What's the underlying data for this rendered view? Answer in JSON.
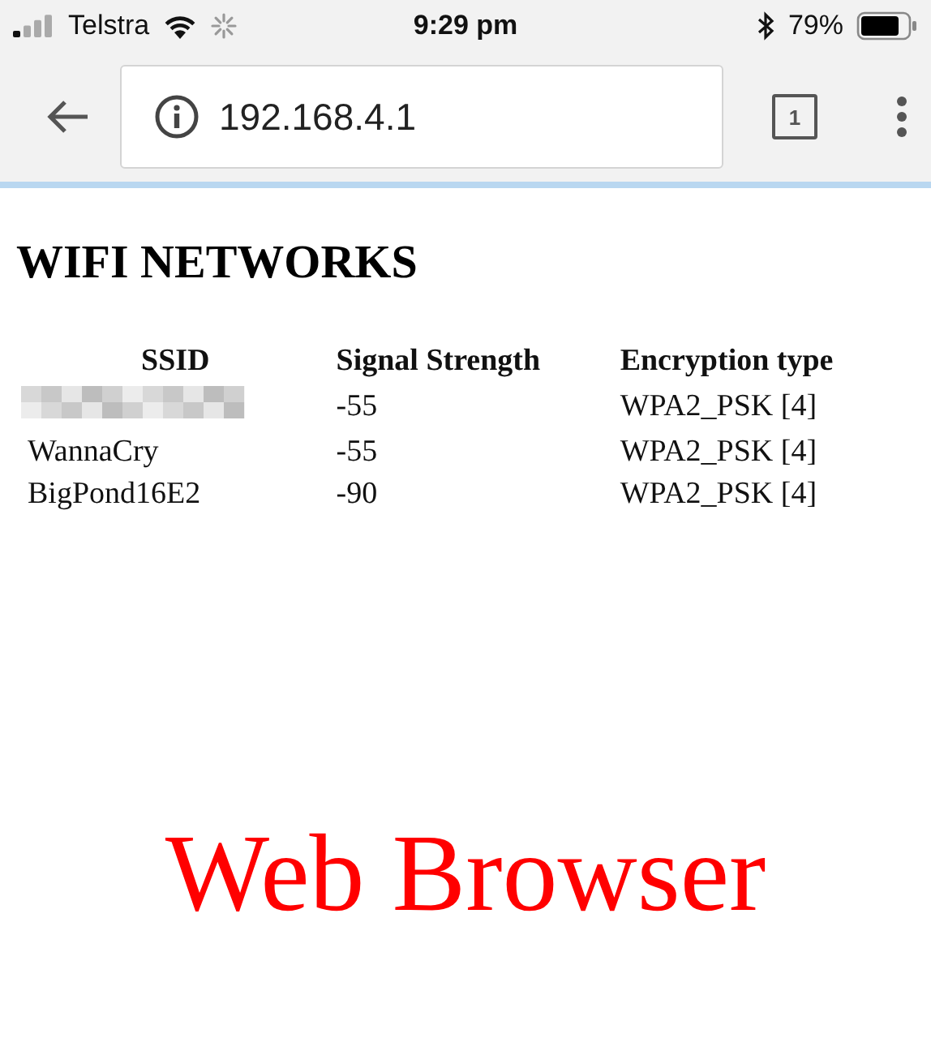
{
  "status_bar": {
    "carrier": "Telstra",
    "time": "9:29 pm",
    "battery": "79%"
  },
  "toolbar": {
    "url": "192.168.4.1",
    "tab_count": "1"
  },
  "page": {
    "title": "WIFI NETWORKS",
    "table": {
      "columns": [
        "SSID",
        "Signal Strength",
        "Encryption type"
      ],
      "rows": [
        {
          "kind": "redacted",
          "signal": "-55",
          "encryption": "WPA2_PSK [4]"
        },
        {
          "kind": "text",
          "ssid": "WannaCry",
          "signal": "-55",
          "encryption": "WPA2_PSK [4]"
        },
        {
          "kind": "text",
          "ssid": "BigPond16E2",
          "signal": "-90",
          "encryption": "WPA2_PSK [4]"
        }
      ]
    }
  },
  "caption": "Web Browser"
}
